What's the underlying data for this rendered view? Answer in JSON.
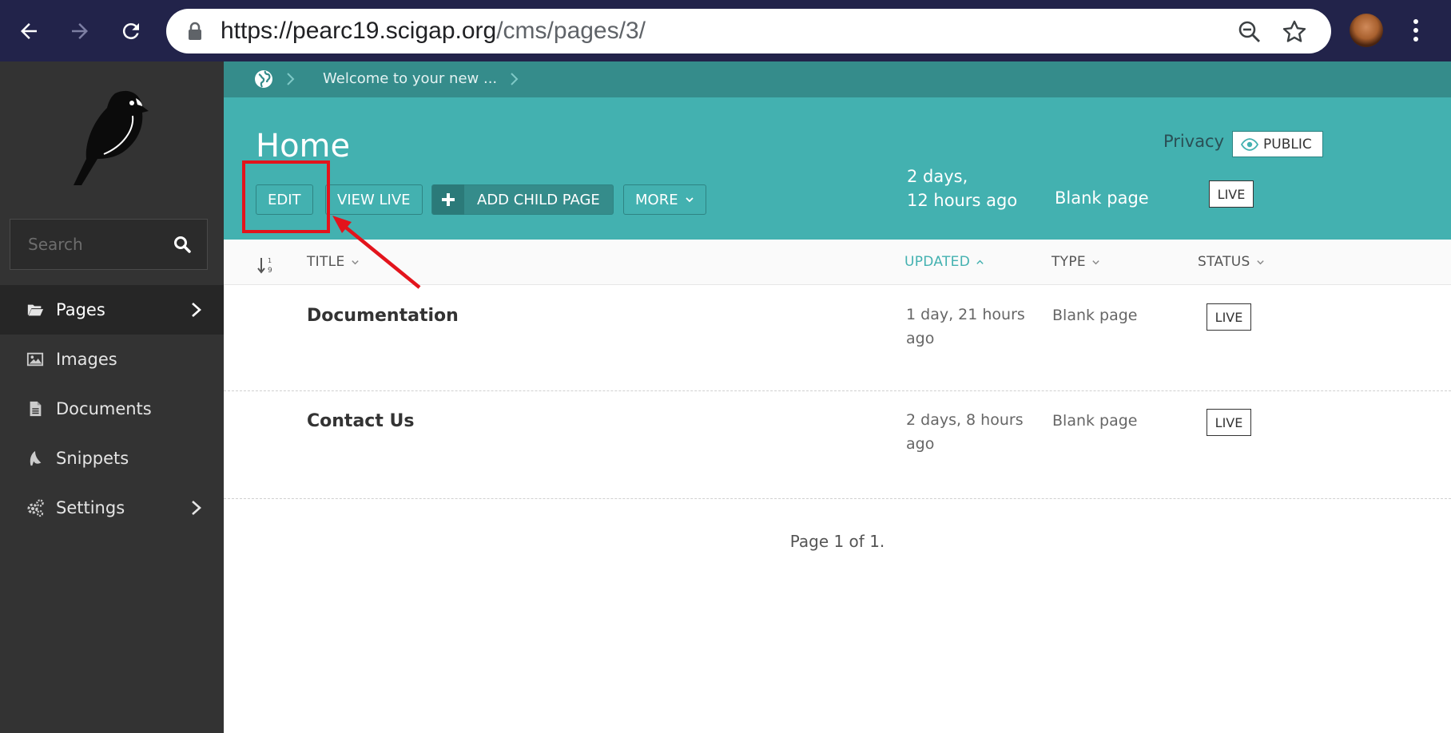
{
  "browser": {
    "url_host": "https://pearc19.scigap.org",
    "url_path": "/cms/pages/3/"
  },
  "sidebar": {
    "search_placeholder": "Search",
    "items": [
      {
        "label": "Pages",
        "icon": "folder-open-icon",
        "active": true,
        "has_submenu": true
      },
      {
        "label": "Images",
        "icon": "image-icon",
        "active": false,
        "has_submenu": false
      },
      {
        "label": "Documents",
        "icon": "document-icon",
        "active": false,
        "has_submenu": false
      },
      {
        "label": "Snippets",
        "icon": "snippet-icon",
        "active": false,
        "has_submenu": false
      },
      {
        "label": "Settings",
        "icon": "cogs-icon",
        "active": false,
        "has_submenu": true
      }
    ]
  },
  "breadcrumb": {
    "current": "Welcome to your new ..."
  },
  "header": {
    "title": "Home",
    "buttons": {
      "edit": "EDIT",
      "view_live": "VIEW LIVE",
      "add_child": "ADD CHILD PAGE",
      "more": "MORE"
    },
    "updated_line1": "2 days,",
    "updated_line2": "12 hours ago",
    "type": "Blank page",
    "status": "LIVE",
    "privacy_label": "Privacy",
    "privacy_value": "PUBLIC"
  },
  "listing": {
    "columns": {
      "title": "TITLE",
      "updated": "UPDATED",
      "type": "TYPE",
      "status": "STATUS"
    },
    "sorted_by": "UPDATED",
    "rows": [
      {
        "title": "Documentation",
        "updated": "1 day, 21 hours ago",
        "type": "Blank page",
        "status": "LIVE"
      },
      {
        "title": "Contact Us",
        "updated": "2 days, 8 hours ago",
        "type": "Blank page",
        "status": "LIVE"
      }
    ],
    "pagination": "Page 1 of 1."
  },
  "colors": {
    "browser_bar": "#22234a",
    "sidebar": "#333333",
    "header_teal": "#43b1b0",
    "breadcrumb_teal": "#358c8b",
    "annotation_red": "#e3141c"
  }
}
